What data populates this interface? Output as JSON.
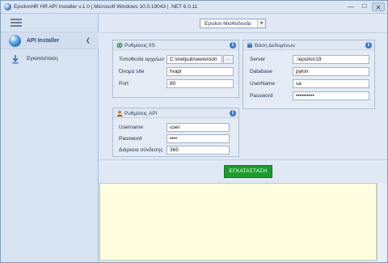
{
  "window": {
    "title": "EpsilonHR HR API Installer v.1.0 | Microsoft Windows 10.0.19043 | .NET 6.0.11",
    "min_glyph": "—",
    "max_glyph": "☐",
    "close_glyph": "✕"
  },
  "sidebar": {
    "group_label": "API Installer",
    "group_chevron": "❮",
    "items": [
      {
        "label": "Εγκατάσταση",
        "icon": "download-arrow-icon"
      }
    ]
  },
  "toolbar": {
    "company_select": "Epsilon Μισθοδοσία",
    "arrow": "▼"
  },
  "iis": {
    "title": "Ρυθμίσεις IIS",
    "folder_label": "Τοποθεσία αρχείων",
    "folder_value": "C:\\inetpub\\wwwroot\\",
    "browse_label": "...",
    "site_label": "Όνομα site",
    "site_value": "hrapi",
    "port_label": "Port",
    "port_value": "80"
  },
  "db": {
    "title": "Βάση Δεδομένων",
    "server_label": "Server",
    "server_value": ".\\epsilon19",
    "database_label": "Database",
    "database_value": "pylon",
    "user_label": "UserName",
    "user_value": "sa",
    "password_label": "Password",
    "password_value": "••••••••••"
  },
  "api": {
    "title": "Ρυθμίσεις API",
    "user_label": "Username",
    "user_value": "user",
    "password_label": "Password",
    "password_value": "••••",
    "duration_label": "Διάρκεια σύνδεσης",
    "duration_value": "365"
  },
  "info_glyph": "i",
  "install_button": "ΕΓΚΑΤΑΣΤΑΣΗ",
  "log_text": "",
  "colors": {
    "install_green": "#1d9c2e",
    "log_background": "#fffde0",
    "accent_blue": "#3d78c9"
  }
}
